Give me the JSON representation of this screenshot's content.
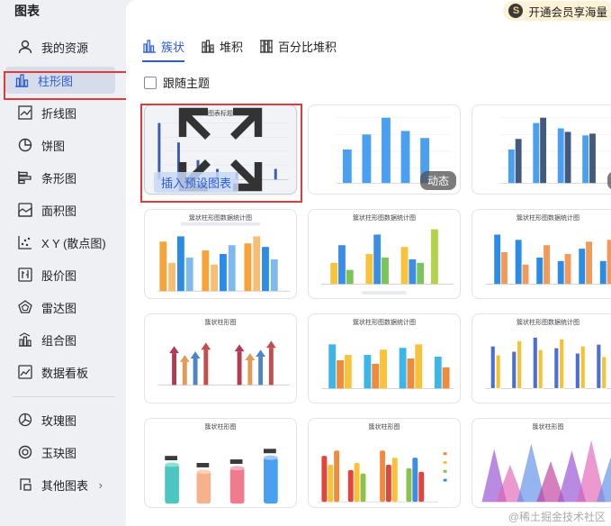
{
  "sidebar": {
    "title": "图表",
    "items": [
      {
        "label": "我的资源",
        "icon": "user-icon"
      },
      {
        "label": "柱形图",
        "icon": "bar-chart-icon",
        "active": true
      },
      {
        "label": "折线图",
        "icon": "line-chart-icon"
      },
      {
        "label": "饼图",
        "icon": "pie-chart-icon"
      },
      {
        "label": "条形图",
        "icon": "horizontal-bar-icon"
      },
      {
        "label": "面积图",
        "icon": "area-chart-icon"
      },
      {
        "label": "X Y (散点图)",
        "icon": "scatter-icon"
      },
      {
        "label": "股价图",
        "icon": "stock-icon"
      },
      {
        "label": "雷达图",
        "icon": "radar-icon"
      },
      {
        "label": "组合图",
        "icon": "combo-chart-icon"
      },
      {
        "label": "数据看板",
        "icon": "dashboard-icon"
      },
      {
        "label": "玫瑰图",
        "icon": "rose-chart-icon"
      },
      {
        "label": "玉玦图",
        "icon": "ring-chart-icon"
      },
      {
        "label": "其他图表",
        "icon": "more-charts-icon"
      }
    ],
    "more_arrow": "›"
  },
  "header": {
    "vip_coin": "S",
    "vip_label": "开通会员享海量"
  },
  "tabs": [
    {
      "label": "簇状",
      "active": true
    },
    {
      "label": "堆积"
    },
    {
      "label": "百分比堆积"
    }
  ],
  "follow_theme": "跟随主题",
  "cards": {
    "c1": {
      "title": "图表标题",
      "insert_label": "插入预设图表"
    },
    "c2": {
      "badge": "动态"
    },
    "c3": {
      "badge": "动态"
    },
    "c4": {
      "title": "簇状柱形图数据统计图"
    },
    "c5": {
      "title": "簇状柱形图数据统计图"
    },
    "c6": {
      "title": "簇状柱形图数据统计图"
    },
    "c7": {
      "title": "簇状柱形图"
    },
    "c8": {
      "title": "簇状柱形图数据统计图"
    },
    "c9": {
      "title": "簇状柱形图数据统计图"
    },
    "c10": {
      "title": "簇状柱形图"
    },
    "c11": {
      "title": "簇状柱形图"
    },
    "c12": {
      "title": "簇状柱形图"
    }
  },
  "watermark": "@稀土掘金技术社区",
  "colors": {
    "accent": "#2b5cd6",
    "highlight": "#e0393e"
  }
}
